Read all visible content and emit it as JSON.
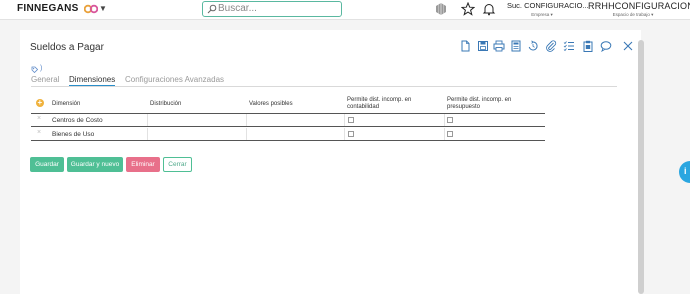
{
  "topbar": {
    "logo_text": "FINNEGANS",
    "search_placeholder": "Buscar...",
    "empresa": {
      "value": "Suc. CONFIGURACIO...",
      "label": "Empresa"
    },
    "workspace": {
      "value": "RRHHCONFIGURACION",
      "label": "Espacio de trabajo"
    }
  },
  "form": {
    "title": "Sueldos a Pagar",
    "tag_text": ")",
    "toolbar": [
      "new-doc-icon",
      "save-icon",
      "print-icon",
      "calculator-icon",
      "history-icon",
      "attach-icon",
      "checklist-icon",
      "clipboard-icon",
      "comment-icon",
      "close-icon"
    ]
  },
  "tabs": [
    {
      "label": "General"
    },
    {
      "label": "Dimensiones"
    },
    {
      "label": "Configuraciones Avanzadas"
    }
  ],
  "grid": {
    "headers": {
      "dimension": "Dimensión",
      "distribucion": "Distribución",
      "valores": "Valores posibles",
      "contab_1": "Permite dist. incomp. en",
      "contab_2": "contabilidad",
      "presu_1": "Permite dist. incomp. en",
      "presu_2": "presupuesto"
    },
    "rows": [
      {
        "dimension": "Centros de Costo",
        "delete": "×"
      },
      {
        "dimension": "Bienes de Uso",
        "delete": "×"
      }
    ]
  },
  "buttons": {
    "guardar": "Guardar",
    "guardar_nuevo": "Guardar y nuevo",
    "eliminar": "Eliminar",
    "cerrar": "Cerrar"
  },
  "colors": {
    "accent_green": "#4fbf95",
    "danger": "#e8708a",
    "tab_underline": "#2a8ec9",
    "fab_blue": "#2aa6e0"
  }
}
